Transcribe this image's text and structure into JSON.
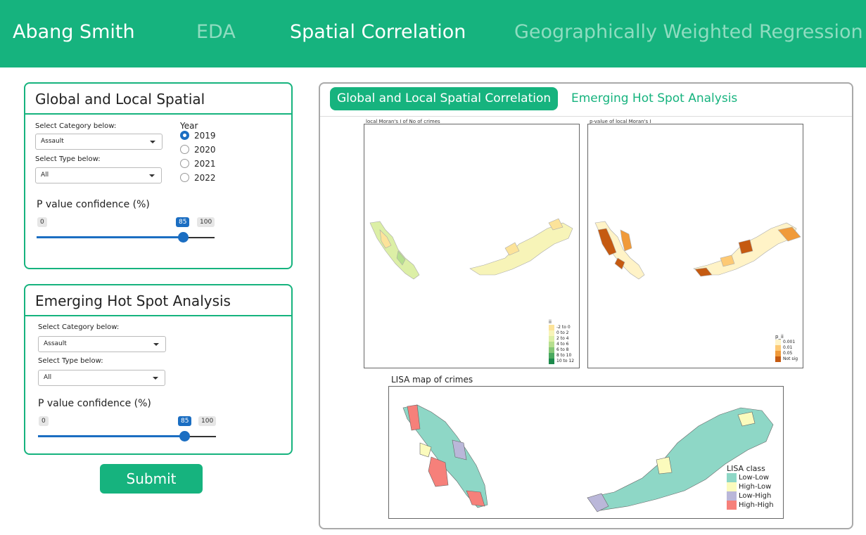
{
  "header": {
    "brand": "Abang Smith",
    "nav": [
      "EDA",
      "Spatial Correlation",
      "Geographically Weighted Regression"
    ]
  },
  "panel1": {
    "title": "Global and Local Spatial",
    "category_label": "Select Category below:",
    "category_value": "Assault",
    "type_label": "Select Type below:",
    "type_value": "All",
    "year_label": "Year",
    "years": [
      "2019",
      "2020",
      "2021",
      "2022"
    ],
    "selected_year": "2019",
    "slider_label": "P value confidence (%)",
    "slider_min": "0",
    "slider_value": "85",
    "slider_max": "100"
  },
  "panel2": {
    "title": "Emerging Hot Spot Analysis",
    "category_label": "Select Category below:",
    "category_value": "Assault",
    "type_label": "Select Type below:",
    "type_value": "All",
    "slider_label": "P value confidence (%)",
    "slider_min": "0",
    "slider_value": "85",
    "slider_max": "100"
  },
  "submit_label": "Submit",
  "tabs": [
    "Global and Local Spatial Correlation",
    "Emerging Hot Spot Analysis"
  ],
  "maps": {
    "moran_title": "local Moran's I of No of crimes",
    "moran_legend_title": "ii",
    "moran_legend": [
      "-2 to 0",
      "0 to 2",
      "2 to 4",
      "4 to 6",
      "6 to 8",
      "8 to 10",
      "10 to 12"
    ],
    "moran_colors": [
      "#fce39a",
      "#f7f4b8",
      "#dcefa6",
      "#b6df8e",
      "#85c777",
      "#4aa95f",
      "#1d8a4c"
    ],
    "pvalue_title": "p-value of local Moran's I",
    "pvalue_legend_title": "p_ii",
    "pvalue_legend": [
      "0.001",
      "0.01",
      "0.05",
      "Not sig"
    ],
    "pvalue_colors": [
      "#fff3c7",
      "#fdc974",
      "#f09a3a",
      "#c55a11"
    ],
    "lisa_title": "LISA map of crimes",
    "lisa_legend_title": "LISA class",
    "lisa_legend": [
      "Low-Low",
      "High-Low",
      "Low-High",
      "High-High"
    ],
    "lisa_colors": [
      "#8ed7c6",
      "#fbfbbd",
      "#bab7d9",
      "#f6807a"
    ]
  }
}
